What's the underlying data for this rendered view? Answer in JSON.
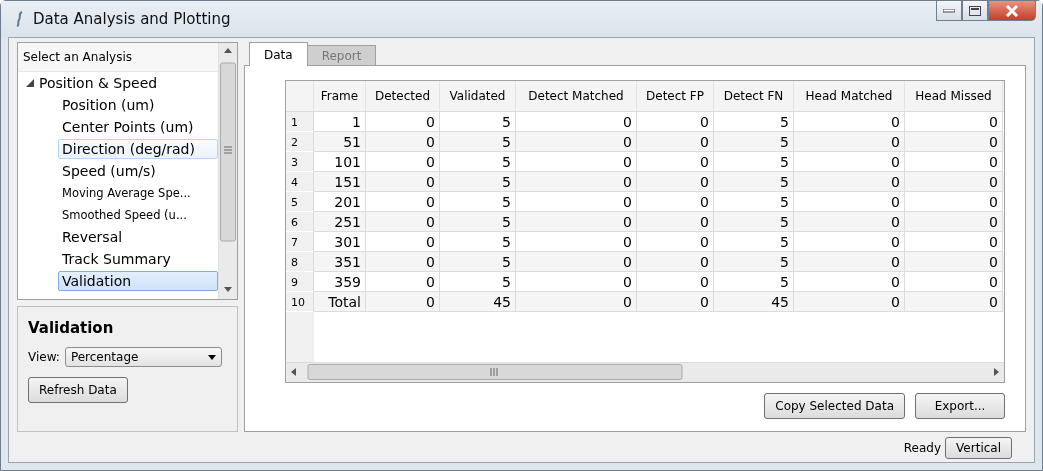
{
  "window": {
    "title": "Data Analysis and Plotting"
  },
  "tree": {
    "header": "Select an Analysis",
    "items": [
      {
        "label": "Position & Speed",
        "expanded": true,
        "children": [
          {
            "label": "Position (um)",
            "kind": "normal",
            "selected": false,
            "hovered": false
          },
          {
            "label": "Center Points (um)",
            "kind": "normal",
            "selected": false,
            "hovered": false
          },
          {
            "label": "Direction (deg/rad)",
            "kind": "normal",
            "selected": false,
            "hovered": true
          },
          {
            "label": "Speed (um/s)",
            "kind": "normal",
            "selected": false,
            "hovered": false
          },
          {
            "label": "Moving Average Spe...",
            "kind": "compact",
            "selected": false,
            "hovered": false
          },
          {
            "label": "Smoothed Speed (u...",
            "kind": "compact",
            "selected": false,
            "hovered": false
          },
          {
            "label": "Reversal",
            "kind": "normal",
            "selected": false,
            "hovered": false
          },
          {
            "label": "Track Summary",
            "kind": "normal",
            "selected": false,
            "hovered": false
          },
          {
            "label": "Validation",
            "kind": "normal",
            "selected": true,
            "hovered": false
          }
        ]
      }
    ]
  },
  "options": {
    "title": "Validation",
    "view_label": "View:",
    "view_value": "Percentage",
    "refresh_button": "Refresh Data"
  },
  "tabs": [
    {
      "label": "Data",
      "selected": true
    },
    {
      "label": "Report",
      "selected": false
    }
  ],
  "table": {
    "columns": [
      "Frame",
      "Detected",
      "Validated",
      "Detect Matched",
      "Detect FP",
      "Detect FN",
      "Head Matched",
      "Head Missed"
    ],
    "rows": [
      {
        "number": "1",
        "cells": [
          "1",
          "0",
          "5",
          "0",
          "0",
          "5",
          "0",
          "0"
        ]
      },
      {
        "number": "2",
        "cells": [
          "51",
          "0",
          "5",
          "0",
          "0",
          "5",
          "0",
          "0"
        ]
      },
      {
        "number": "3",
        "cells": [
          "101",
          "0",
          "5",
          "0",
          "0",
          "5",
          "0",
          "0"
        ]
      },
      {
        "number": "4",
        "cells": [
          "151",
          "0",
          "5",
          "0",
          "0",
          "5",
          "0",
          "0"
        ]
      },
      {
        "number": "5",
        "cells": [
          "201",
          "0",
          "5",
          "0",
          "0",
          "5",
          "0",
          "0"
        ]
      },
      {
        "number": "6",
        "cells": [
          "251",
          "0",
          "5",
          "0",
          "0",
          "5",
          "0",
          "0"
        ]
      },
      {
        "number": "7",
        "cells": [
          "301",
          "0",
          "5",
          "0",
          "0",
          "5",
          "0",
          "0"
        ]
      },
      {
        "number": "8",
        "cells": [
          "351",
          "0",
          "5",
          "0",
          "0",
          "5",
          "0",
          "0"
        ]
      },
      {
        "number": "9",
        "cells": [
          "359",
          "0",
          "5",
          "0",
          "0",
          "5",
          "0",
          "0"
        ]
      },
      {
        "number": "10",
        "cells": [
          "Total",
          "0",
          "45",
          "0",
          "0",
          "45",
          "0",
          "0"
        ]
      }
    ]
  },
  "buttons": [
    "Copy Selected Data",
    "Export..."
  ],
  "status_bar": {
    "message": "Ready",
    "toggle": "Vertical"
  }
}
